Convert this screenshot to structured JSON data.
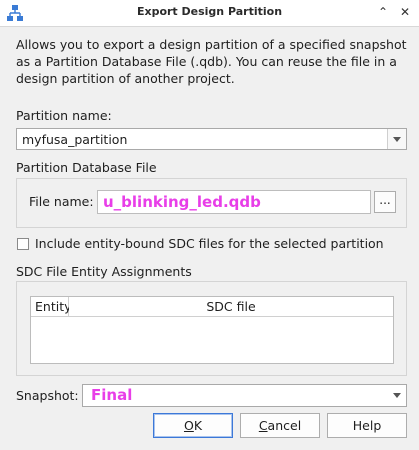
{
  "window": {
    "title": "Export Design Partition",
    "icon": "hierarchy-icon",
    "chevron_symbol": "⌃",
    "close_symbol": "✕"
  },
  "description": "Allows you to export a design partition of a specified snapshot as a Partition Database File (.qdb). You can reuse the file in a design partition of another project.",
  "partition_name": {
    "label": "Partition name:",
    "value": "myfusa_partition"
  },
  "partition_db": {
    "group_label": "Partition Database File",
    "file_label": "File name:",
    "file_value": "u_blinking_led.qdb",
    "browse_label": "..."
  },
  "include_sdc": {
    "label": "Include entity-bound SDC files for the selected partition",
    "checked": false
  },
  "sdc_assignments": {
    "group_label": "SDC File Entity Assignments",
    "columns": [
      "Entity",
      "SDC file"
    ]
  },
  "snapshot": {
    "label": "Snapshot:",
    "value": "Final"
  },
  "buttons": {
    "ok": {
      "first": "O",
      "rest": "K"
    },
    "cancel": {
      "first": "C",
      "rest": "ancel"
    },
    "help": "Help"
  },
  "colors": {
    "highlight_text": "#e83ee8",
    "default_button_border": "#3c78d8"
  }
}
